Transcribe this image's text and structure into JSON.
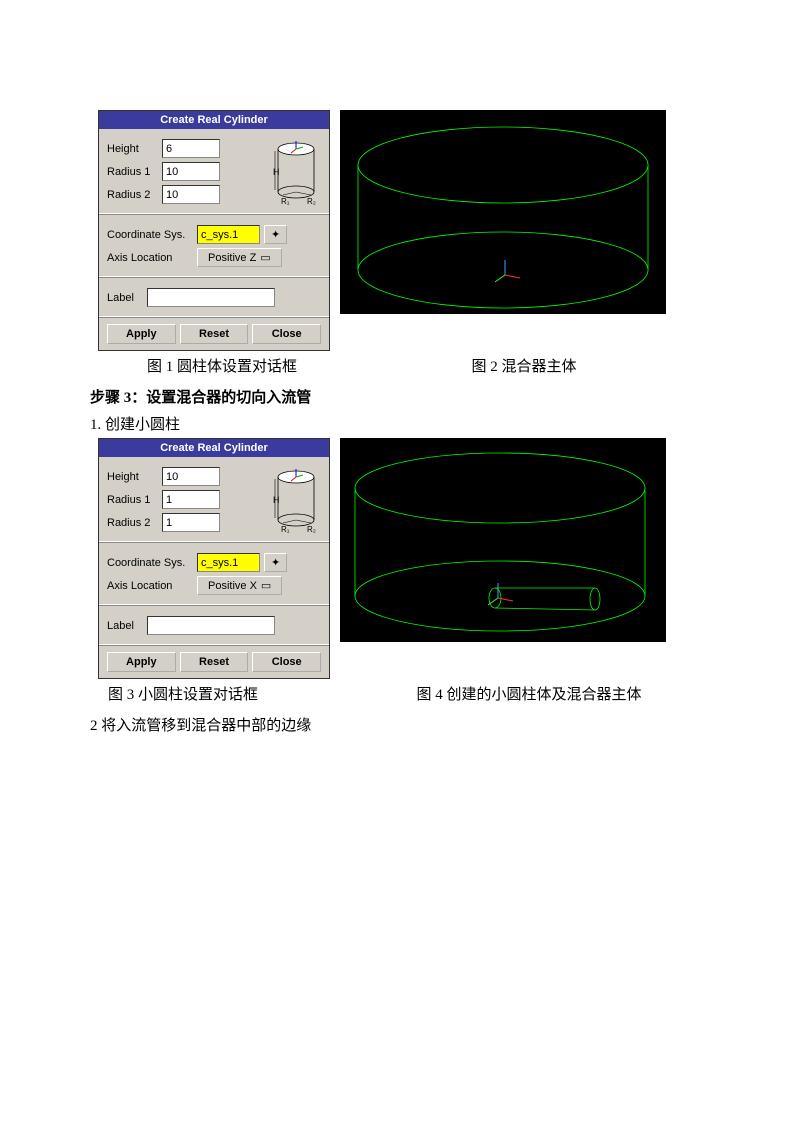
{
  "dialog1": {
    "title": "Create Real Cylinder",
    "height_label": "Height",
    "height_value": "6",
    "r1_label": "Radius 1",
    "r1_value": "10",
    "r2_label": "Radius 2",
    "r2_value": "10",
    "coord_label": "Coordinate Sys.",
    "coord_value": "c_sys.1",
    "axis_label": "Axis Location",
    "axis_value": "Positive Z",
    "label_label": "Label",
    "label_value": "",
    "apply": "Apply",
    "reset": "Reset",
    "close": "Close"
  },
  "caption1": "图 1 圆柱体设置对话框",
  "caption2": "图 2 混合器主体",
  "step3_heading": "步骤 3：设置混合器的切向入流管",
  "step3_sub1": "1.  创建小圆柱",
  "dialog2": {
    "title": "Create Real Cylinder",
    "height_label": "Height",
    "height_value": "10",
    "r1_label": "Radius 1",
    "r1_value": "1",
    "r2_label": "Radius 2",
    "r2_value": "1",
    "coord_label": "Coordinate Sys.",
    "coord_value": "c_sys.1",
    "axis_label": "Axis Location",
    "axis_value": "Positive X",
    "label_label": "Label",
    "label_value": "",
    "apply": "Apply",
    "reset": "Reset",
    "close": "Close"
  },
  "caption3": "图 3 小圆柱设置对话框",
  "caption4": "图 4 创建的小圆柱体及混合器主体",
  "step3_sub2": "2 将入流管移到混合器中部的边缘",
  "diag": {
    "H": "H",
    "R1": "R₁",
    "R2": "R₂"
  }
}
